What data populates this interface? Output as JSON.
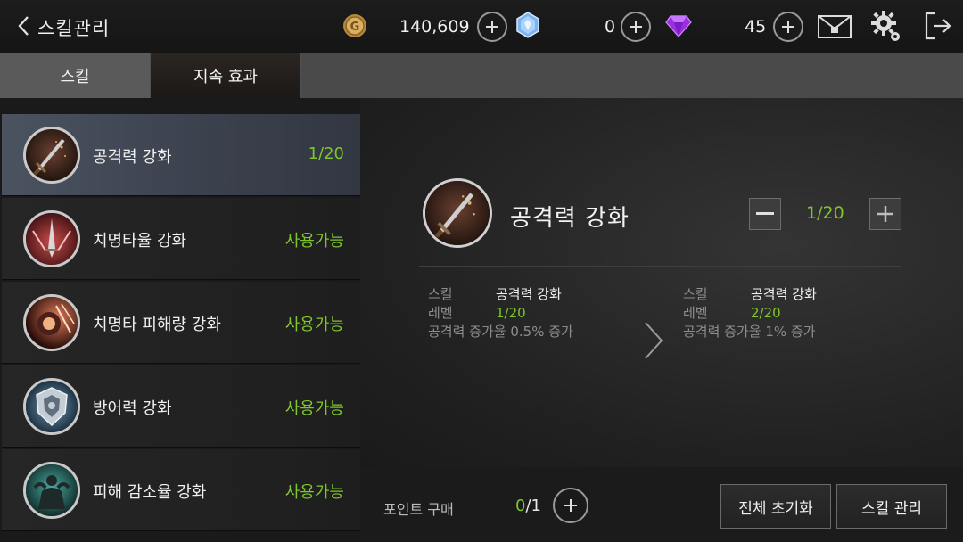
{
  "header": {
    "title": "스킬관리",
    "gold": "140,609",
    "crystal": "0",
    "gem": "45"
  },
  "tabs": [
    {
      "label": "스킬",
      "active": false
    },
    {
      "label": "지속 효과",
      "active": true
    }
  ],
  "skills": [
    {
      "name": "공격력 강화",
      "status": "1/20",
      "icon": "sword-icon",
      "selected": true
    },
    {
      "name": "치명타율 강화",
      "status": "사용가능",
      "icon": "critical-slash-icon",
      "selected": false
    },
    {
      "name": "치명타 피해량 강화",
      "status": "사용가능",
      "icon": "critical-damage-icon",
      "selected": false
    },
    {
      "name": "방어력 강화",
      "status": "사용가능",
      "icon": "armor-icon",
      "selected": false
    },
    {
      "name": "피해 감소율 강화",
      "status": "사용가능",
      "icon": "damage-reduction-icon",
      "selected": false
    }
  ],
  "detail": {
    "name": "공격력 강화",
    "level": "1/20",
    "current": {
      "skill_label": "스킬",
      "skill_value": "공격력 강화",
      "level_label": "레벨",
      "level_value": "1/20",
      "effect": "공격력 증가율 0.5% 증가"
    },
    "next": {
      "skill_label": "스킬",
      "skill_value": "공격력 강화",
      "level_label": "레벨",
      "level_value": "2/20",
      "effect": "공격력 증가율 1% 증가"
    }
  },
  "footer": {
    "points_label": "포인트 구매",
    "points_used": "0",
    "points_total": "/1",
    "reset_label": "전체 초기화",
    "manage_label": "스킬 관리"
  },
  "colors": {
    "accent_green": "#7ec62a",
    "selected_row": "#4b5361"
  }
}
